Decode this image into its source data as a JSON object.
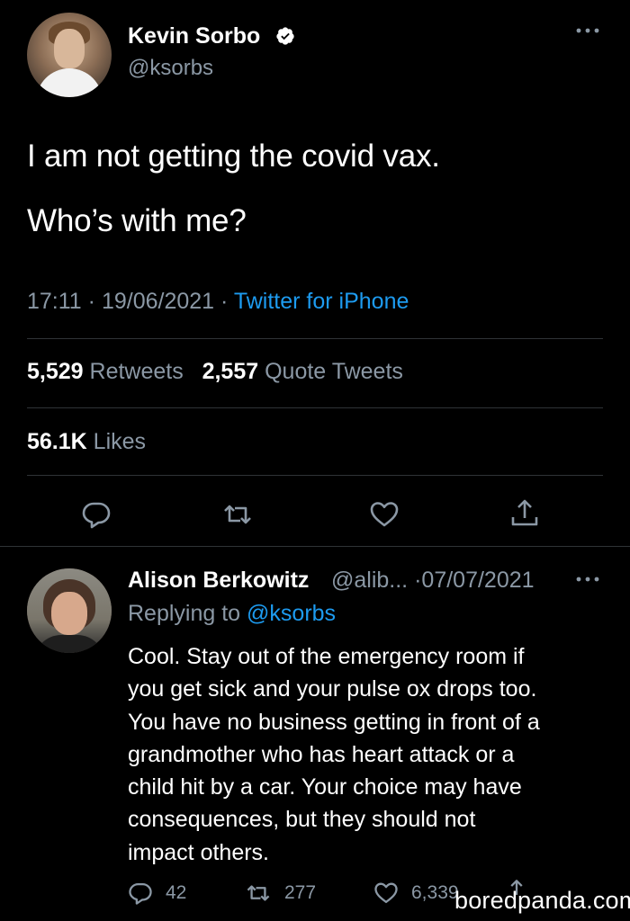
{
  "tweet": {
    "author": {
      "display_name": "Kevin Sorbo",
      "handle": "@ksorbs",
      "verified_icon": "verified-badge-icon"
    },
    "text_lines": [
      "I am not getting the covid vax.",
      "Who’s with me?"
    ],
    "time": "17:11",
    "date": "19/06/2021",
    "source": "Twitter for iPhone",
    "separator": "·",
    "stats": {
      "retweets_count": "5,529",
      "retweets_label": "Retweets",
      "quotes_count": "2,557",
      "quotes_label": "Quote Tweets",
      "likes_count": "56.1K",
      "likes_label": "Likes"
    },
    "actions": [
      "reply-icon",
      "retweet-icon",
      "like-icon",
      "share-icon"
    ]
  },
  "reply": {
    "author": {
      "display_name": "Alison Berkowitz",
      "handle_truncated": "@alib...",
      "date": "07/07/2021"
    },
    "replying_to_label": "Replying to",
    "replying_to_handle": "@ksorbs",
    "text_lines": [
      "Cool. Stay out of the emergency room if",
      "you get sick and your pulse ox drops too.",
      "You have no business getting in front of a",
      "grandmother who has heart attack or a",
      "child hit by a car. Your choice may have",
      "consequences, but they should not",
      "impact others."
    ],
    "counts": {
      "replies": "42",
      "retweets": "277",
      "likes": "6,339"
    }
  },
  "watermark": "boredpanda.com",
  "colors": {
    "background": "#000000",
    "text_primary": "#ffffff",
    "text_secondary": "#8b98a5",
    "accent": "#1d9bf0",
    "divider": "#2f3336"
  }
}
